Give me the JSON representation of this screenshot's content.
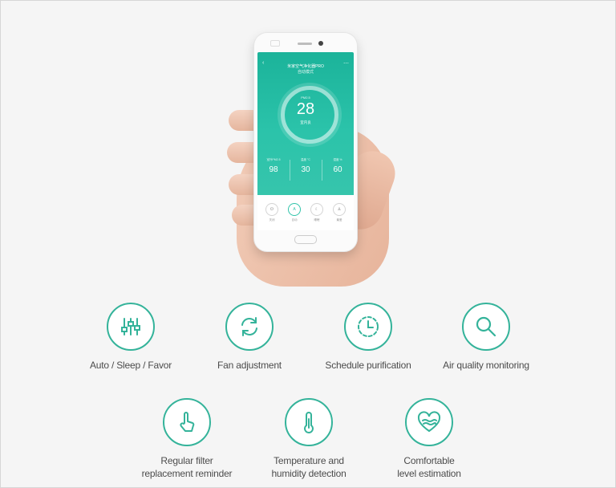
{
  "phone": {
    "app_title": "米家空气净化器PRO",
    "mode_text": "自动模式",
    "pm_label": "PM2.5",
    "pm_value": "28",
    "pm_status": "室内良",
    "stats": [
      {
        "label": "室外PM2.5",
        "value": "98"
      },
      {
        "label": "温度 °C",
        "value": "30"
      },
      {
        "label": "湿度 %",
        "value": "60"
      }
    ],
    "controls": [
      {
        "label": "关闭"
      },
      {
        "label": "自动"
      },
      {
        "label": "睡眠"
      },
      {
        "label": "最爱"
      }
    ]
  },
  "features_row1": [
    {
      "label_lines": [
        "Auto / Sleep / Favor"
      ],
      "icon": "sliders-icon"
    },
    {
      "label_lines": [
        "Fan adjustment"
      ],
      "icon": "refresh-icon"
    },
    {
      "label_lines": [
        "Schedule purification"
      ],
      "icon": "clock-icon"
    },
    {
      "label_lines": [
        "Air quality monitoring"
      ],
      "icon": "magnifier-icon"
    }
  ],
  "features_row2": [
    {
      "label_lines": [
        "Regular filter",
        "replacement reminder"
      ],
      "icon": "hand-pointer-icon"
    },
    {
      "label_lines": [
        "Temperature and",
        "humidity detection"
      ],
      "icon": "thermometer-icon"
    },
    {
      "label_lines": [
        "Comfortable",
        "level estimation"
      ],
      "icon": "heart-waves-icon"
    }
  ],
  "colors": {
    "accent": "#34b39a",
    "screen_teal": "#2bc3aa",
    "text": "#4c4c4c"
  }
}
